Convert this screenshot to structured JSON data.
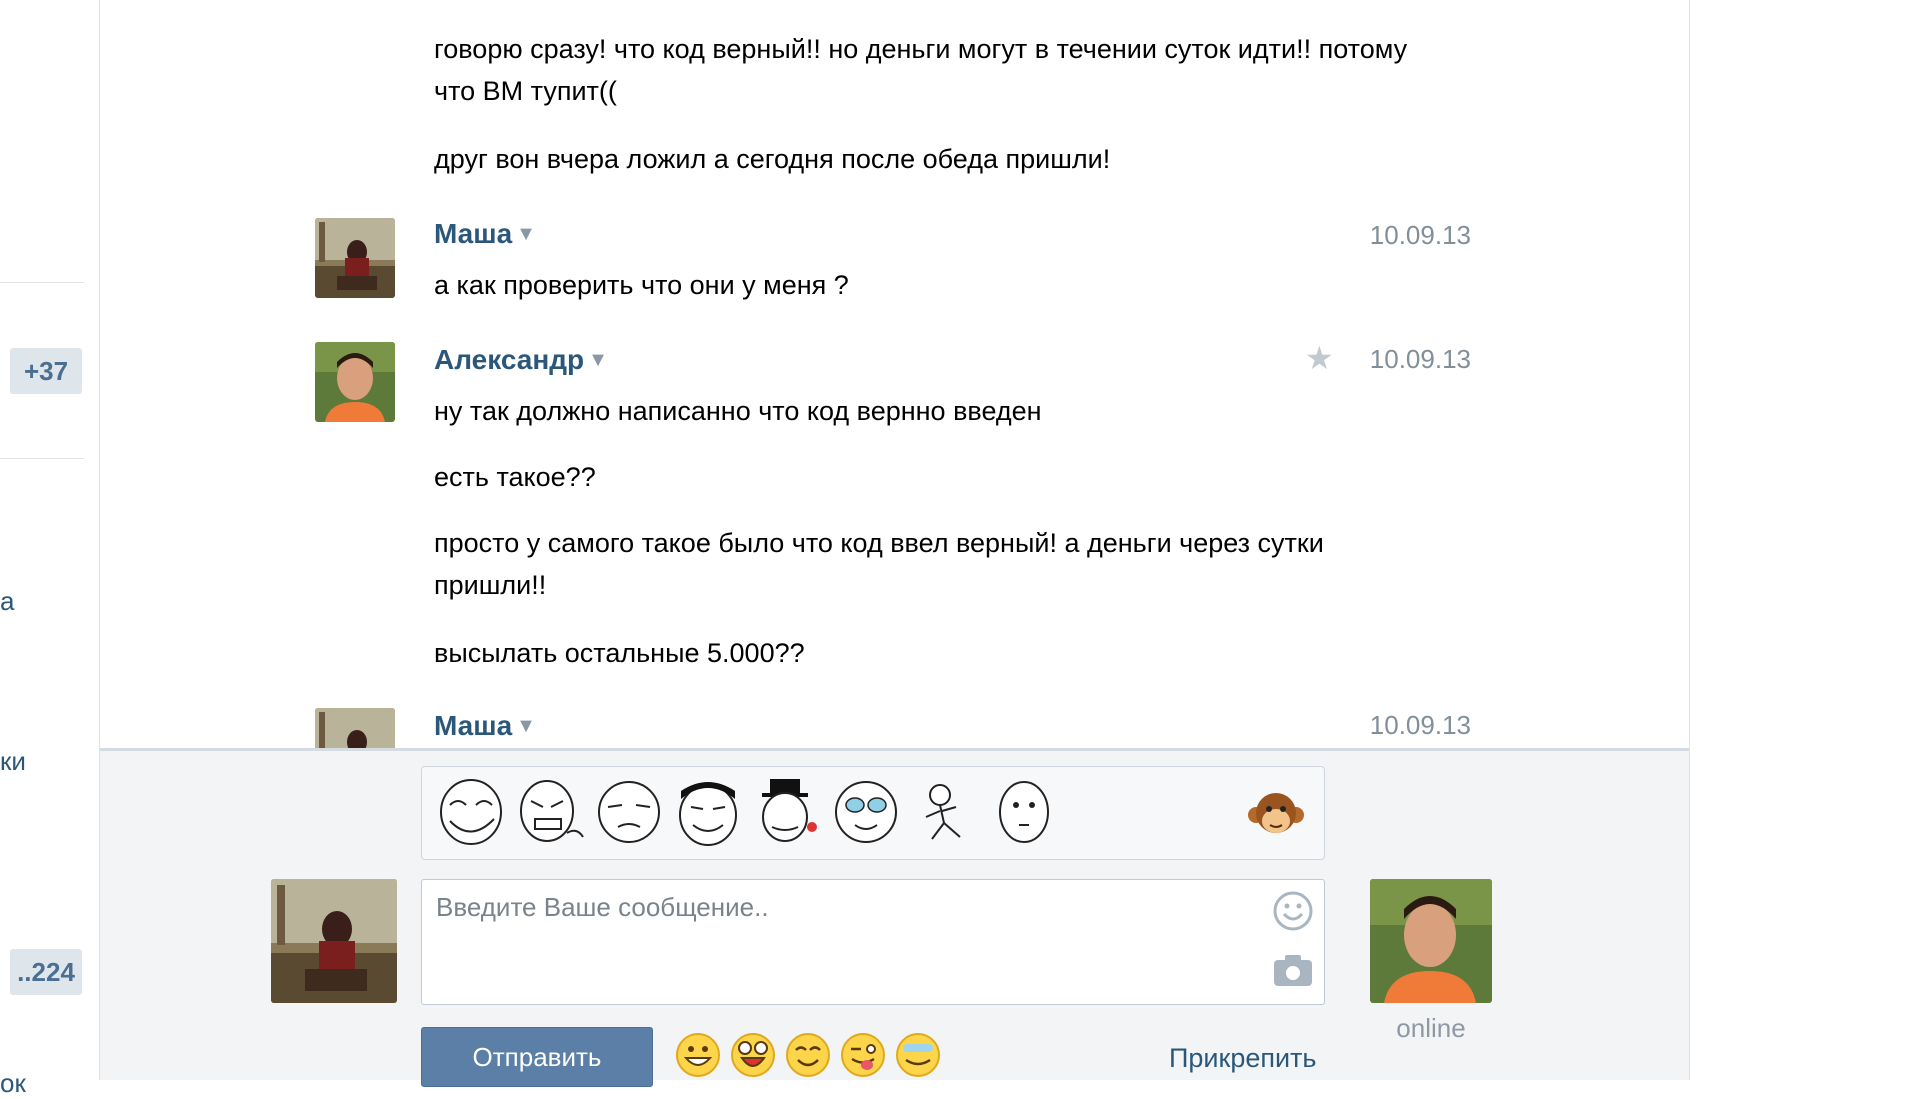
{
  "left_sidebar": {
    "counter_top": "+37",
    "counter_bottom": "..224",
    "fragments": [
      "а",
      "ки",
      "ок"
    ]
  },
  "messages": [
    {
      "type": "continuation",
      "lines": [
        "говорю сразу! что код верный!! но деньги могут в течении суток идти!! потому что ВМ тупит((",
        "друг вон вчера ложил а сегодня после обеда пришли!"
      ]
    },
    {
      "type": "message",
      "author": "Маша",
      "date": "10.09.13",
      "lines": [
        "а как проверить что они у меня ?"
      ]
    },
    {
      "type": "message",
      "author": "Александр",
      "date": "10.09.13",
      "lines": [
        "ну так должно написанно что код вернно введен",
        "есть такое??",
        "просто у самого такое было что код ввел верный! а деньги через сутки пришли!!",
        "высылать остальные 5.000??"
      ]
    },
    {
      "type": "message",
      "author": "Маша",
      "date": "10.09.13",
      "lines": []
    }
  ],
  "composer": {
    "placeholder": "Введите Ваше сообщение..",
    "send_label": "Отправить",
    "attach_label": "Прикрепить",
    "online_label": "online",
    "stickers": [
      "troll-face-sticker",
      "rage-face-sticker",
      "suspicious-face-sticker",
      "yao-ming-sticker",
      "like-a-sir-sticker",
      "happy-tears-sticker",
      "running-man-sticker",
      "poker-face-sticker"
    ],
    "emojis": [
      "grin-emoji",
      "surprised-emoji",
      "smile-emoji",
      "wink-tongue-emoji",
      "sweat-emoji"
    ]
  },
  "colors": {
    "link": "#2b587a",
    "send_button": "#5b7fa6",
    "composer_bg": "#f2f4f6"
  }
}
